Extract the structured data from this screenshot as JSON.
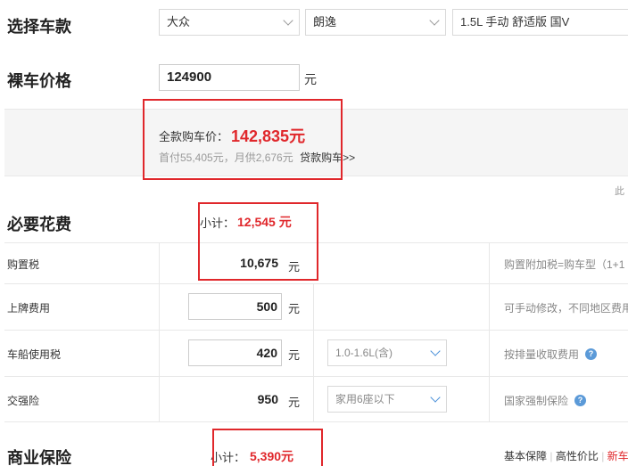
{
  "select_car": {
    "title": "选择车款",
    "brand": "大众",
    "series": "朗逸",
    "model": "1.5L 手动 舒适版 国V"
  },
  "bare_price": {
    "title": "裸车价格",
    "value": "124900",
    "unit": "元"
  },
  "summary": {
    "total_label": "全款购车价：",
    "total_value": "142,835元",
    "detail": "首付55,405元，月供2,676元",
    "loan_link": "贷款购车>>",
    "side_text": "此"
  },
  "required": {
    "title": "必要花费",
    "subtotal_label": "小计：",
    "subtotal_value": "12,545 元",
    "rows": [
      {
        "label": "购置税",
        "value": "10,675",
        "unit": "元",
        "note": "购置附加税=购车型（1+1"
      },
      {
        "label": "上牌费用",
        "value": "500",
        "unit": "元",
        "note": "可手动修改，不同地区费用"
      },
      {
        "label": "车船使用税",
        "value": "420",
        "unit": "元",
        "option": "1.0-1.6L(含)",
        "note": "按排量收取费用"
      },
      {
        "label": "交强险",
        "value": "950",
        "unit": "元",
        "option": "家用6座以下",
        "note": "国家强制保险"
      }
    ]
  },
  "commercial": {
    "title": "商业保险",
    "subtotal_label": "小计：",
    "subtotal_value": "5,390元",
    "tabs": [
      "基本保障",
      "高性价比",
      "新车"
    ],
    "sep": "|"
  },
  "colors": {
    "accent_red": "#e0272b",
    "info_blue": "#5b9ad8"
  }
}
